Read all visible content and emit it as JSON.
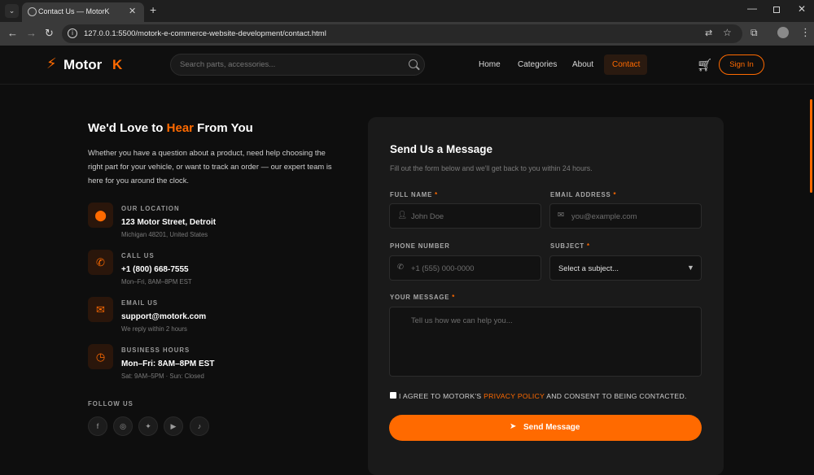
{
  "browser": {
    "tab_title": "Contact Us — MotorK",
    "new_tab_glyph": "+",
    "url": "127.0.0.1:5500/motork-e-commerce-website-development/contact.html"
  },
  "header": {
    "logo_main": "Motor ",
    "logo_accent": "K",
    "search_placeholder": "Search parts, accessories...",
    "nav": [
      "Home",
      "Categories",
      "About",
      "Contact"
    ],
    "signin_label": "Sign In"
  },
  "info": {
    "heading_pre": "We'd Love to ",
    "heading_hl": "Hear",
    "heading_post": " From You",
    "intro": "Whether you have a question about a product, need help choosing the right part for your vehicle, or want to track an order — our expert team is here for you around the clock.",
    "items": [
      {
        "label": "OUR LOCATION",
        "value": "123 Motor Street, Detroit",
        "sub": "Michigan 48201, United States",
        "icon": "location-icon"
      },
      {
        "label": "CALL US",
        "value": "+1 (800) 668-7555",
        "sub": "Mon–Fri, 8AM–8PM EST",
        "icon": "phone-icon"
      },
      {
        "label": "EMAIL US",
        "value": "support@motork.com",
        "sub": "We reply within 2 hours",
        "icon": "mail-icon"
      },
      {
        "label": "BUSINESS HOURS",
        "value": "Mon–Fri: 8AM–8PM EST",
        "sub": "Sat: 9AM–5PM · Sun: Closed",
        "icon": "clock-icon"
      }
    ],
    "follow_label": "FOLLOW US"
  },
  "form": {
    "title": "Send Us a Message",
    "subtitle": "Fill out the form below and we'll get back to you within 24 hours.",
    "full_name_label": "FULL NAME",
    "full_name_placeholder": "John Doe",
    "email_label": "EMAIL ADDRESS",
    "email_placeholder": "you@example.com",
    "phone_label": "PHONE NUMBER",
    "phone_placeholder": "+1 (555) 000-0000",
    "subject_label": "SUBJECT",
    "subject_value": "Select a subject...",
    "message_label": "YOUR MESSAGE",
    "message_placeholder": "Tell us how we can help you...",
    "required_mark": "*",
    "consent_pre": "I AGREE TO MOTORK'S ",
    "consent_link": "PRIVACY POLICY",
    "consent_post": " AND CONSENT TO BEING CONTACTED.",
    "send_label": "Send Message"
  },
  "colors": {
    "accent": "#ff6a00",
    "background": "#0e0e0e",
    "card": "#1a1a1a"
  }
}
